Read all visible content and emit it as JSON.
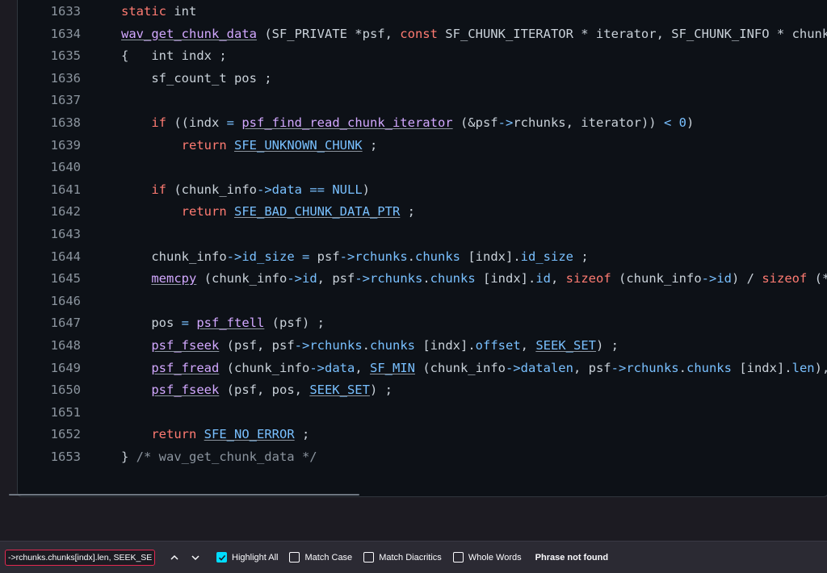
{
  "editor": {
    "lines": [
      {
        "n": "1633",
        "toks": [
          [
            "    ",
            "t"
          ],
          [
            "static",
            "k"
          ],
          [
            " int",
            "t"
          ]
        ]
      },
      {
        "n": "1634",
        "toks": [
          [
            "    ",
            "t"
          ],
          [
            "wav_get_chunk_data",
            "f u"
          ],
          [
            " (SF_PRIVATE *psf, ",
            "t"
          ],
          [
            "const",
            "k"
          ],
          [
            " SF_CHUNK_ITERATOR * iterator, SF_CHUNK_INFO * chunk_",
            "t"
          ]
        ]
      },
      {
        "n": "1635",
        "toks": [
          [
            "    {   int indx ;",
            "t"
          ]
        ]
      },
      {
        "n": "1636",
        "toks": [
          [
            "        sf_count_t pos ;",
            "t"
          ]
        ]
      },
      {
        "n": "1637",
        "toks": []
      },
      {
        "n": "1638",
        "toks": [
          [
            "        ",
            "t"
          ],
          [
            "if",
            "k"
          ],
          [
            " ((indx ",
            "t"
          ],
          [
            "=",
            "o"
          ],
          [
            " ",
            "t"
          ],
          [
            "psf_find_read_chunk_iterator",
            "f u"
          ],
          [
            " (&psf",
            "t"
          ],
          [
            "->",
            "o"
          ],
          [
            "rchunks, iterator)) ",
            "t"
          ],
          [
            "<",
            "o"
          ],
          [
            " ",
            "t"
          ],
          [
            "0",
            "c"
          ],
          [
            ")",
            "t"
          ]
        ]
      },
      {
        "n": "1639",
        "toks": [
          [
            "            ",
            "t"
          ],
          [
            "return",
            "k"
          ],
          [
            " ",
            "t"
          ],
          [
            "SFE_UNKNOWN_CHUNK",
            "c u"
          ],
          [
            " ;",
            "t"
          ]
        ]
      },
      {
        "n": "1640",
        "toks": []
      },
      {
        "n": "1641",
        "toks": [
          [
            "        ",
            "t"
          ],
          [
            "if",
            "k"
          ],
          [
            " (chunk_info",
            "t"
          ],
          [
            "->",
            "o"
          ],
          [
            "data ",
            "c"
          ],
          [
            "==",
            "o"
          ],
          [
            " ",
            "t"
          ],
          [
            "NULL",
            "c"
          ],
          [
            ")",
            "t"
          ]
        ]
      },
      {
        "n": "1642",
        "toks": [
          [
            "            ",
            "t"
          ],
          [
            "return",
            "k"
          ],
          [
            " ",
            "t"
          ],
          [
            "SFE_BAD_CHUNK_DATA_PTR",
            "c u"
          ],
          [
            " ;",
            "t"
          ]
        ]
      },
      {
        "n": "1643",
        "toks": []
      },
      {
        "n": "1644",
        "toks": [
          [
            "        chunk_info",
            "t"
          ],
          [
            "->",
            "o"
          ],
          [
            "id_size",
            "c"
          ],
          [
            " ",
            "t"
          ],
          [
            "=",
            "o"
          ],
          [
            " psf",
            "t"
          ],
          [
            "->",
            "o"
          ],
          [
            "rchunks",
            "c"
          ],
          [
            ".",
            "t"
          ],
          [
            "chunks",
            "c"
          ],
          [
            " [indx].",
            "t"
          ],
          [
            "id_size",
            "c"
          ],
          [
            " ;",
            "t"
          ]
        ]
      },
      {
        "n": "1645",
        "toks": [
          [
            "        ",
            "t"
          ],
          [
            "memcpy",
            "f u"
          ],
          [
            " (chunk_info",
            "t"
          ],
          [
            "->",
            "o"
          ],
          [
            "id",
            "c"
          ],
          [
            ", psf",
            "t"
          ],
          [
            "->",
            "o"
          ],
          [
            "rchunks",
            "c"
          ],
          [
            ".",
            "t"
          ],
          [
            "chunks",
            "c"
          ],
          [
            " [indx].",
            "t"
          ],
          [
            "id",
            "c"
          ],
          [
            ", ",
            "t"
          ],
          [
            "sizeof",
            "k"
          ],
          [
            " (chunk_info",
            "t"
          ],
          [
            "->",
            "o"
          ],
          [
            "id",
            "c"
          ],
          [
            ") / ",
            "t"
          ],
          [
            "sizeof",
            "k"
          ],
          [
            " (*c",
            "t"
          ]
        ]
      },
      {
        "n": "1646",
        "toks": []
      },
      {
        "n": "1647",
        "toks": [
          [
            "        pos ",
            "t"
          ],
          [
            "=",
            "o"
          ],
          [
            " ",
            "t"
          ],
          [
            "psf_ftell",
            "f u"
          ],
          [
            " (psf) ;",
            "t"
          ]
        ]
      },
      {
        "n": "1648",
        "toks": [
          [
            "        ",
            "t"
          ],
          [
            "psf_fseek",
            "f u"
          ],
          [
            " (psf, psf",
            "t"
          ],
          [
            "->",
            "o"
          ],
          [
            "rchunks",
            "c"
          ],
          [
            ".",
            "t"
          ],
          [
            "chunks",
            "c"
          ],
          [
            " [indx].",
            "t"
          ],
          [
            "offset",
            "c"
          ],
          [
            ", ",
            "t"
          ],
          [
            "SEEK_SET",
            "c u"
          ],
          [
            ") ;",
            "t"
          ]
        ]
      },
      {
        "n": "1649",
        "toks": [
          [
            "        ",
            "t"
          ],
          [
            "psf_fread",
            "f u"
          ],
          [
            " (chunk_info",
            "t"
          ],
          [
            "->",
            "o"
          ],
          [
            "data",
            "c"
          ],
          [
            ", ",
            "t"
          ],
          [
            "SF_MIN",
            "c u"
          ],
          [
            " (chunk_info",
            "t"
          ],
          [
            "->",
            "o"
          ],
          [
            "datalen",
            "c"
          ],
          [
            ", psf",
            "t"
          ],
          [
            "->",
            "o"
          ],
          [
            "rchunks",
            "c"
          ],
          [
            ".",
            "t"
          ],
          [
            "chunks",
            "c"
          ],
          [
            " [indx].",
            "t"
          ],
          [
            "len",
            "c"
          ],
          [
            "),",
            "t"
          ]
        ]
      },
      {
        "n": "1650",
        "toks": [
          [
            "        ",
            "t"
          ],
          [
            "psf_fseek",
            "f u"
          ],
          [
            " (psf, pos, ",
            "t"
          ],
          [
            "SEEK_SET",
            "c u"
          ],
          [
            ") ;",
            "t"
          ]
        ]
      },
      {
        "n": "1651",
        "toks": []
      },
      {
        "n": "1652",
        "toks": [
          [
            "        ",
            "t"
          ],
          [
            "return",
            "k"
          ],
          [
            " ",
            "t"
          ],
          [
            "SFE_NO_ERROR",
            "c u"
          ],
          [
            " ;",
            "t"
          ]
        ]
      },
      {
        "n": "1653",
        "toks": [
          [
            "    } ",
            "t"
          ],
          [
            "/* wav_get_chunk_data */",
            "cm"
          ]
        ]
      }
    ]
  },
  "findbar": {
    "query": "->rchunks.chunks[indx].len, SEEK_SET)",
    "highlight_all": {
      "label": "Highlight All",
      "checked": true
    },
    "match_case": {
      "label": "Match Case",
      "checked": false
    },
    "match_diacritics": {
      "label": "Match Diacritics",
      "checked": false
    },
    "whole_words": {
      "label": "Whole Words",
      "checked": false
    },
    "status": "Phrase not found"
  },
  "colors": {
    "keyword": "#ff7b72",
    "function": "#d2a8ff",
    "constant": "#79c0ff",
    "text": "#c9d1d9",
    "line_number": "#8b949e",
    "find_input_border": "#e22850",
    "checkbox_checked": "#00ddff"
  },
  "icons": {
    "previous": "chevron-up-icon",
    "next": "chevron-down-icon",
    "check": "check-icon"
  }
}
